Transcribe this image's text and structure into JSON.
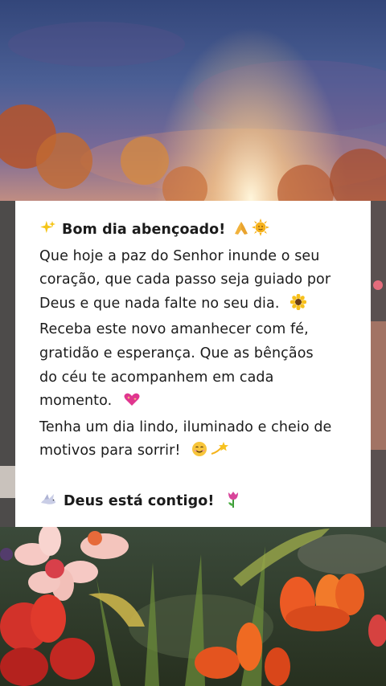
{
  "message": {
    "heading": "Bom dia abençoado!",
    "line1": "Que hoje a paz do Senhor inunde o seu",
    "line2": "coração, que cada passo seja guiado por",
    "line3": "Deus e que nada falte no seu dia.",
    "line4": "Receba este novo amanhecer com fé,",
    "line5": "gratidão e esperança. Que as bênçãos",
    "line6": "do céu te acompanhem em cada",
    "line7": "momento.",
    "line8": "Tenha um dia lindo, iluminado e cheio de",
    "line9": "motivos para sorrir!",
    "closing": "Deus está contigo!"
  },
  "icons": [
    "sparkles-icon",
    "praying-hands-icon",
    "sun-face-icon",
    "sunflower-icon",
    "sparkling-heart-icon",
    "smiling-face-icon",
    "dizzy-star-icon",
    "dove-icon",
    "tulip-icon"
  ],
  "colors": {
    "card": "#ffffff",
    "text": "#1b1b1b",
    "sky_top": "#3a4a7a",
    "sunrise": "#f2b27a"
  }
}
